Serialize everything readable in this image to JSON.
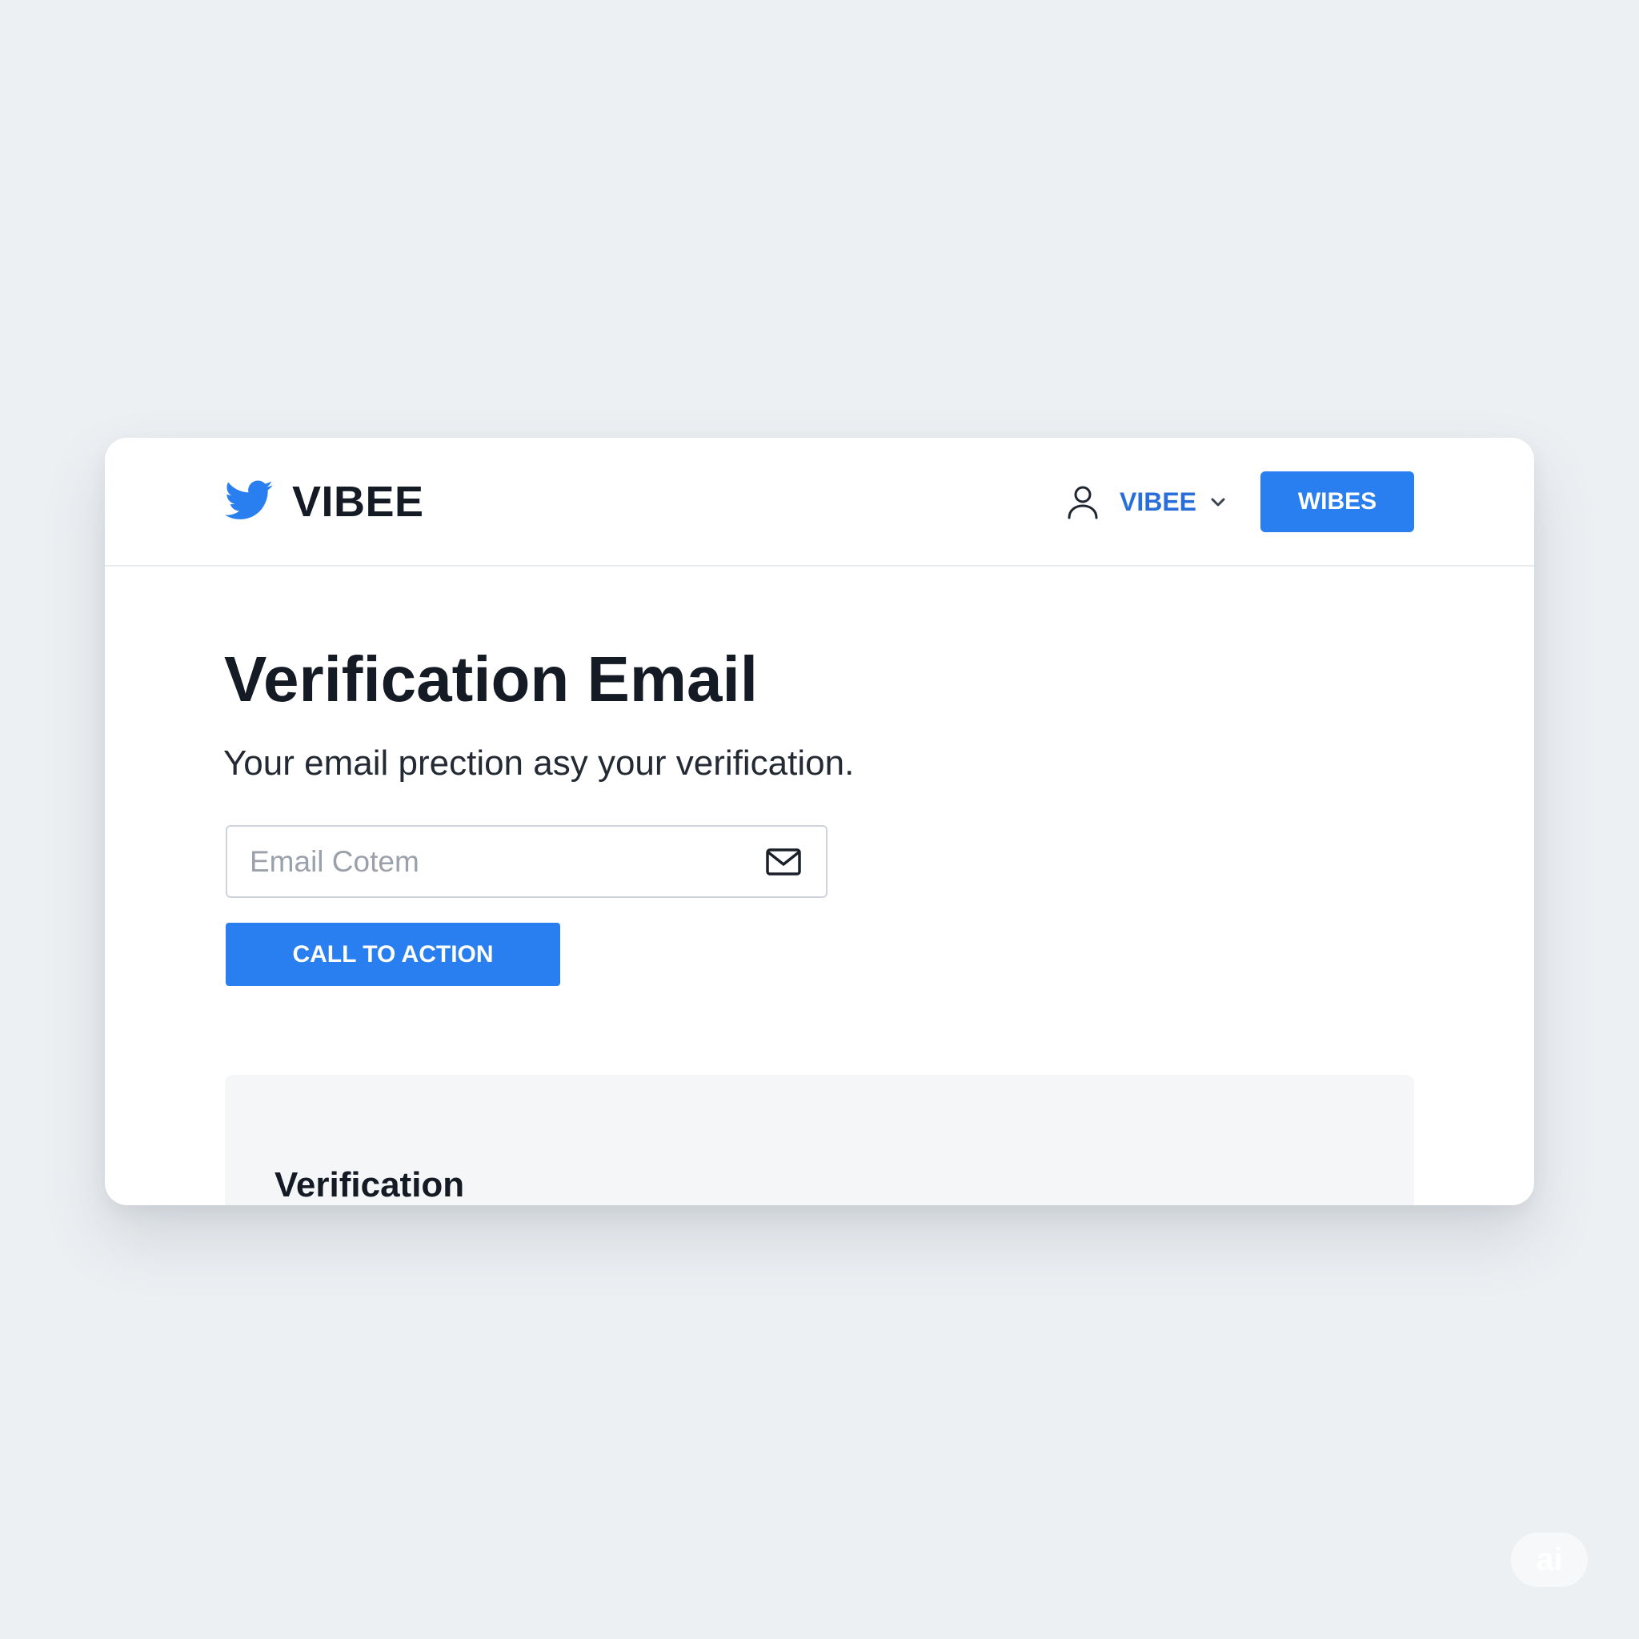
{
  "header": {
    "brand_name": "VIBEE",
    "user_menu_label": "VIBEE",
    "action_button_label": "WIBES"
  },
  "main": {
    "title": "Verification Email",
    "subtitle": "Your email prection asy your verification.",
    "email_input": {
      "placeholder": "Email Cotem",
      "value": ""
    },
    "cta_label": "CALL TO ACTION"
  },
  "panel": {
    "heading": "Verification"
  },
  "badge": {
    "label": "ai"
  },
  "icons": {
    "brand": "bird-icon",
    "user": "user-icon",
    "menu": "chevron-down-icon",
    "email": "mail-icon"
  },
  "colors": {
    "accent": "#2A7FF0",
    "link": "#2A6FD9",
    "background": "#EDF0F3",
    "card": "#FFFFFF",
    "heading": "#151B24"
  }
}
